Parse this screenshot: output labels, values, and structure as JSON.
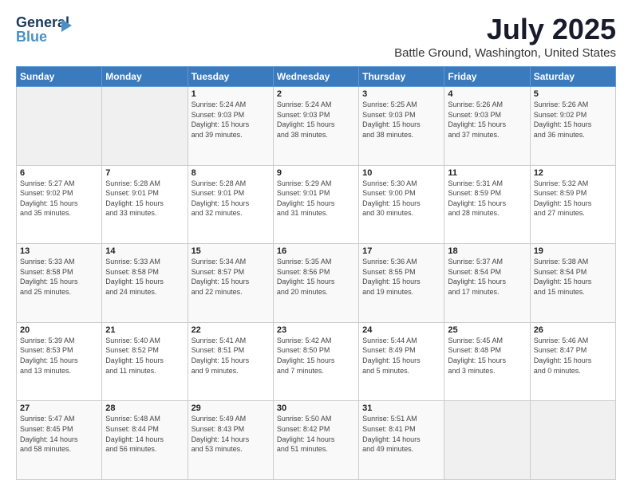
{
  "header": {
    "logo_line1": "General",
    "logo_line2": "Blue",
    "main_title": "July 2025",
    "subtitle": "Battle Ground, Washington, United States"
  },
  "days_of_week": [
    "Sunday",
    "Monday",
    "Tuesday",
    "Wednesday",
    "Thursday",
    "Friday",
    "Saturday"
  ],
  "weeks": [
    [
      {
        "day": "",
        "info": ""
      },
      {
        "day": "",
        "info": ""
      },
      {
        "day": "1",
        "info": "Sunrise: 5:24 AM\nSunset: 9:03 PM\nDaylight: 15 hours\nand 39 minutes."
      },
      {
        "day": "2",
        "info": "Sunrise: 5:24 AM\nSunset: 9:03 PM\nDaylight: 15 hours\nand 38 minutes."
      },
      {
        "day": "3",
        "info": "Sunrise: 5:25 AM\nSunset: 9:03 PM\nDaylight: 15 hours\nand 38 minutes."
      },
      {
        "day": "4",
        "info": "Sunrise: 5:26 AM\nSunset: 9:03 PM\nDaylight: 15 hours\nand 37 minutes."
      },
      {
        "day": "5",
        "info": "Sunrise: 5:26 AM\nSunset: 9:02 PM\nDaylight: 15 hours\nand 36 minutes."
      }
    ],
    [
      {
        "day": "6",
        "info": "Sunrise: 5:27 AM\nSunset: 9:02 PM\nDaylight: 15 hours\nand 35 minutes."
      },
      {
        "day": "7",
        "info": "Sunrise: 5:28 AM\nSunset: 9:01 PM\nDaylight: 15 hours\nand 33 minutes."
      },
      {
        "day": "8",
        "info": "Sunrise: 5:28 AM\nSunset: 9:01 PM\nDaylight: 15 hours\nand 32 minutes."
      },
      {
        "day": "9",
        "info": "Sunrise: 5:29 AM\nSunset: 9:01 PM\nDaylight: 15 hours\nand 31 minutes."
      },
      {
        "day": "10",
        "info": "Sunrise: 5:30 AM\nSunset: 9:00 PM\nDaylight: 15 hours\nand 30 minutes."
      },
      {
        "day": "11",
        "info": "Sunrise: 5:31 AM\nSunset: 8:59 PM\nDaylight: 15 hours\nand 28 minutes."
      },
      {
        "day": "12",
        "info": "Sunrise: 5:32 AM\nSunset: 8:59 PM\nDaylight: 15 hours\nand 27 minutes."
      }
    ],
    [
      {
        "day": "13",
        "info": "Sunrise: 5:33 AM\nSunset: 8:58 PM\nDaylight: 15 hours\nand 25 minutes."
      },
      {
        "day": "14",
        "info": "Sunrise: 5:33 AM\nSunset: 8:58 PM\nDaylight: 15 hours\nand 24 minutes."
      },
      {
        "day": "15",
        "info": "Sunrise: 5:34 AM\nSunset: 8:57 PM\nDaylight: 15 hours\nand 22 minutes."
      },
      {
        "day": "16",
        "info": "Sunrise: 5:35 AM\nSunset: 8:56 PM\nDaylight: 15 hours\nand 20 minutes."
      },
      {
        "day": "17",
        "info": "Sunrise: 5:36 AM\nSunset: 8:55 PM\nDaylight: 15 hours\nand 19 minutes."
      },
      {
        "day": "18",
        "info": "Sunrise: 5:37 AM\nSunset: 8:54 PM\nDaylight: 15 hours\nand 17 minutes."
      },
      {
        "day": "19",
        "info": "Sunrise: 5:38 AM\nSunset: 8:54 PM\nDaylight: 15 hours\nand 15 minutes."
      }
    ],
    [
      {
        "day": "20",
        "info": "Sunrise: 5:39 AM\nSunset: 8:53 PM\nDaylight: 15 hours\nand 13 minutes."
      },
      {
        "day": "21",
        "info": "Sunrise: 5:40 AM\nSunset: 8:52 PM\nDaylight: 15 hours\nand 11 minutes."
      },
      {
        "day": "22",
        "info": "Sunrise: 5:41 AM\nSunset: 8:51 PM\nDaylight: 15 hours\nand 9 minutes."
      },
      {
        "day": "23",
        "info": "Sunrise: 5:42 AM\nSunset: 8:50 PM\nDaylight: 15 hours\nand 7 minutes."
      },
      {
        "day": "24",
        "info": "Sunrise: 5:44 AM\nSunset: 8:49 PM\nDaylight: 15 hours\nand 5 minutes."
      },
      {
        "day": "25",
        "info": "Sunrise: 5:45 AM\nSunset: 8:48 PM\nDaylight: 15 hours\nand 3 minutes."
      },
      {
        "day": "26",
        "info": "Sunrise: 5:46 AM\nSunset: 8:47 PM\nDaylight: 15 hours\nand 0 minutes."
      }
    ],
    [
      {
        "day": "27",
        "info": "Sunrise: 5:47 AM\nSunset: 8:45 PM\nDaylight: 14 hours\nand 58 minutes."
      },
      {
        "day": "28",
        "info": "Sunrise: 5:48 AM\nSunset: 8:44 PM\nDaylight: 14 hours\nand 56 minutes."
      },
      {
        "day": "29",
        "info": "Sunrise: 5:49 AM\nSunset: 8:43 PM\nDaylight: 14 hours\nand 53 minutes."
      },
      {
        "day": "30",
        "info": "Sunrise: 5:50 AM\nSunset: 8:42 PM\nDaylight: 14 hours\nand 51 minutes."
      },
      {
        "day": "31",
        "info": "Sunrise: 5:51 AM\nSunset: 8:41 PM\nDaylight: 14 hours\nand 49 minutes."
      },
      {
        "day": "",
        "info": ""
      },
      {
        "day": "",
        "info": ""
      }
    ]
  ]
}
